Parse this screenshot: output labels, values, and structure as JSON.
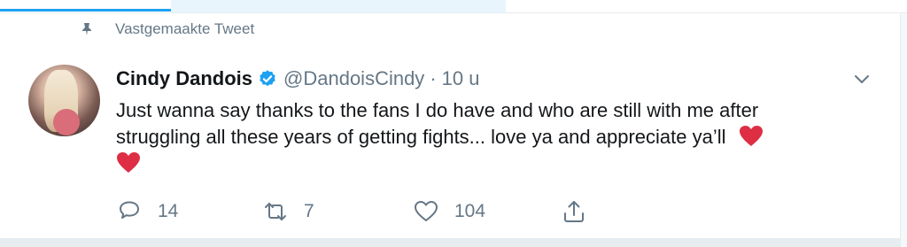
{
  "tabs": {
    "active_accent": "#1da1f2"
  },
  "pinned": {
    "label": "Vastgemaakte Tweet",
    "icon": "pin-icon"
  },
  "tweet": {
    "author": {
      "display_name": "Cindy Dandois",
      "verified": true,
      "handle": "@DandoisCindy",
      "avatar": "avatar"
    },
    "separator": "·",
    "time": "10 u",
    "text_lines": [
      "Just wanna say thanks to the fans I do have and who are still with me after",
      "struggling all these years of getting fights... love ya and appreciate ya’ll"
    ],
    "emoji": "red-heart",
    "actions": {
      "reply_count": "14",
      "retweet_count": "7",
      "like_count": "104"
    }
  },
  "colors": {
    "text_primary": "#14171a",
    "text_secondary": "#657786",
    "verified_badge": "#1da1f2",
    "heart_emoji": "#dd2e44",
    "background": "#e6ecf0"
  }
}
